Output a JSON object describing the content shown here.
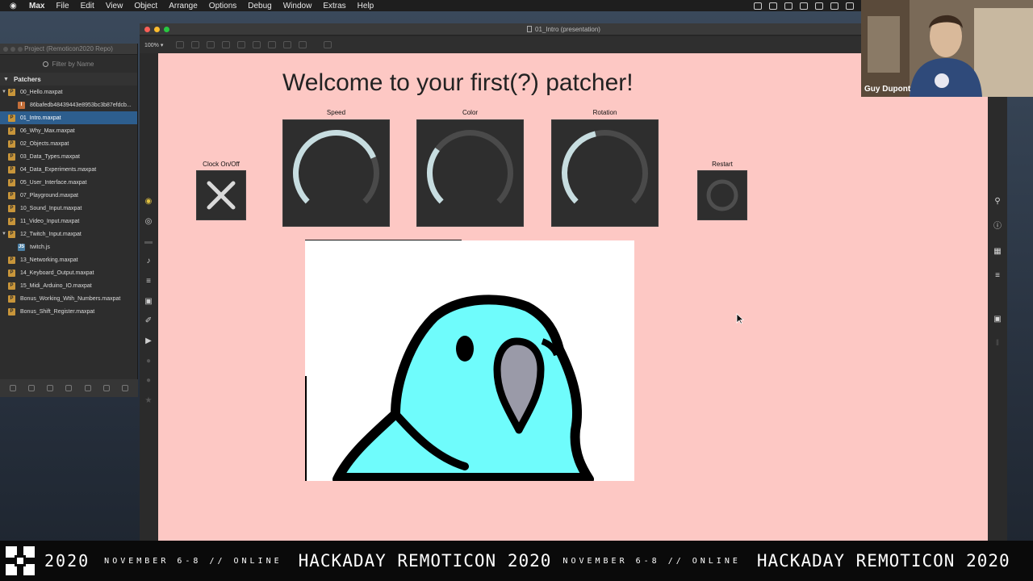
{
  "menubar": {
    "app": "Max",
    "items": [
      "File",
      "Edit",
      "View",
      "Object",
      "Arrange",
      "Options",
      "Debug",
      "Window",
      "Extras",
      "Help"
    ]
  },
  "project": {
    "title": "Project (Remoticon2020 Repo)",
    "filter_placeholder": "Filter by Name",
    "section": "Patchers",
    "items": [
      {
        "label": "00_Hello.maxpat",
        "type": "patcher",
        "expanded": true
      },
      {
        "label": "86bafedb48439443e8953bc3b87efdcb...",
        "type": "image",
        "child": true
      },
      {
        "label": "01_Intro.maxpat",
        "type": "patcher",
        "selected": true
      },
      {
        "label": "06_Why_Max.maxpat",
        "type": "patcher"
      },
      {
        "label": "02_Objects.maxpat",
        "type": "patcher"
      },
      {
        "label": "03_Data_Types.maxpat",
        "type": "patcher"
      },
      {
        "label": "04_Data_Experiments.maxpat",
        "type": "patcher"
      },
      {
        "label": "05_User_Interface.maxpat",
        "type": "patcher"
      },
      {
        "label": "07_Playground.maxpat",
        "type": "patcher"
      },
      {
        "label": "10_Sound_Input.maxpat",
        "type": "patcher"
      },
      {
        "label": "11_Video_Input.maxpat",
        "type": "patcher"
      },
      {
        "label": "12_Twitch_Input.maxpat",
        "type": "patcher",
        "expanded": true
      },
      {
        "label": "twitch.js",
        "type": "js",
        "child": true
      },
      {
        "label": "13_Networking.maxpat",
        "type": "patcher"
      },
      {
        "label": "14_Keyboard_Output.maxpat",
        "type": "patcher"
      },
      {
        "label": "15_Midi_Arduino_IO.maxpat",
        "type": "patcher"
      },
      {
        "label": "Bonus_Working_Wtih_Numbers.maxpat",
        "type": "patcher"
      },
      {
        "label": "Bonus_Shift_Register.maxpat",
        "type": "patcher"
      }
    ]
  },
  "window": {
    "title": "01_Intro (presentation)",
    "zoom": "100%"
  },
  "patcher": {
    "headline": "Welcome to your first(?) patcher!",
    "clock_label": "Clock On/Off",
    "dials": [
      {
        "label": "Speed",
        "value": 0.75
      },
      {
        "label": "Color",
        "value": 0.3
      },
      {
        "label": "Rotation",
        "value": 0.45
      }
    ],
    "restart_label": "Restart"
  },
  "webcam": {
    "name": "Guy Dupont"
  },
  "banner": {
    "year": "2020",
    "dates": "NOVEMBER 6-8 // ONLINE",
    "event": "HACKADAY REMOTICON 2020",
    "dates2": "NOVEMBER 6-8 // ONLINE",
    "event2": "HACKADAY REMOTICON 2020"
  },
  "colors": {
    "canvas": "#fdc8c4",
    "dial_bg": "#2e2e2e",
    "dial_track": "#4a4a4a",
    "dial_fill": "#c7dde0",
    "parrot_body": "#6ffcfc",
    "parrot_beak": "#9a9aa8",
    "selection": "#2d5e8e"
  }
}
